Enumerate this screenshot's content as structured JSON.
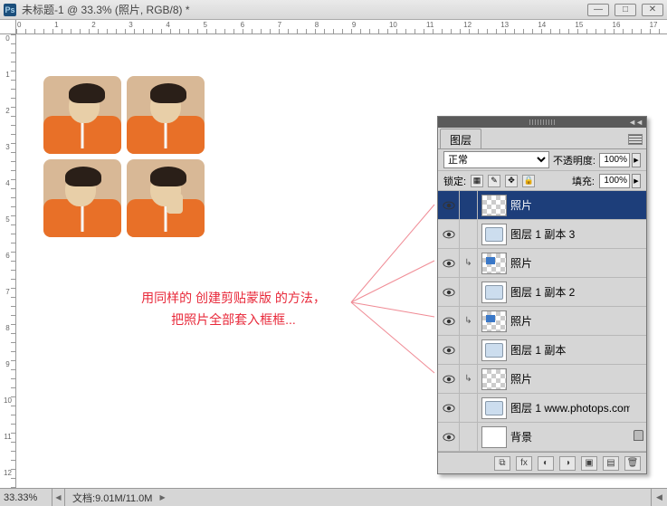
{
  "title": "未标题-1 @ 33.3% (照片, RGB/8) *",
  "ps_logo": "Ps",
  "ruler_h": [
    "0",
    "",
    "1",
    "",
    "2",
    "",
    "3",
    "",
    "4",
    "",
    "5",
    "",
    "6",
    "",
    "7",
    "",
    "8",
    "",
    "9",
    "",
    "10",
    "",
    "11",
    "",
    "12",
    "",
    "13",
    "",
    "14",
    "",
    "15",
    "",
    "16",
    "",
    "17"
  ],
  "ruler_v": [
    "0",
    "1",
    "2",
    "3",
    "4",
    "5",
    "6",
    "7",
    "8",
    "9",
    "10",
    "11",
    "12"
  ],
  "annotation": {
    "line1": "用同样的 创建剪贴蒙版 的方法，",
    "line2": "把照片全部套入框框..."
  },
  "panel": {
    "tab": "图层",
    "blend_mode": "正常",
    "opacity_label": "不透明度:",
    "opacity_value": "100%",
    "lock_label": "锁定:",
    "fill_label": "填充:",
    "fill_value": "100%"
  },
  "layers": [
    {
      "name": "照片",
      "selected": true,
      "thumb": "checker",
      "clip": false,
      "lock": false
    },
    {
      "name": "图层 1 副本 3",
      "thumb": "frame",
      "clip": false,
      "lock": false
    },
    {
      "name": "照片",
      "thumb": "mini",
      "clip": true,
      "lock": false
    },
    {
      "name": "图层 1 副本 2",
      "thumb": "frame",
      "clip": false,
      "lock": false
    },
    {
      "name": "照片",
      "thumb": "mini",
      "clip": true,
      "lock": false
    },
    {
      "name": "图层 1 副本",
      "thumb": "frame",
      "clip": false,
      "lock": false
    },
    {
      "name": "照片",
      "thumb": "checker",
      "clip": true,
      "lock": false
    },
    {
      "name": "图层 1  www.photops.com",
      "thumb": "frame",
      "clip": false,
      "lock": false
    },
    {
      "name": "背景",
      "thumb": "white",
      "clip": false,
      "lock": true
    }
  ],
  "status": {
    "zoom": "33.33%",
    "doc_label": "文档:",
    "doc_size": "9.01M/11.0M"
  }
}
